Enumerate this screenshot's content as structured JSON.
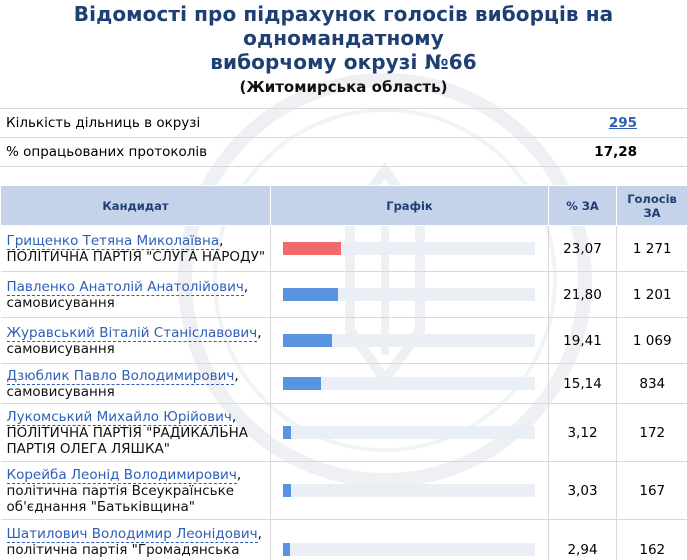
{
  "header": {
    "title_line1": "Відомості про підрахунок голосів виборців на одномандатному",
    "title_line2": "виборчому окрузі №66",
    "region": "(Житомирська область)"
  },
  "summary": {
    "stations_label": "Кількість дільниць в окрузі",
    "stations_value": "295",
    "protocols_label": "% опрацьованих протоколів",
    "protocols_value": "17,28"
  },
  "table": {
    "columns": {
      "candidate": "Кандидат",
      "graph": "Графік",
      "percent": "% ЗА",
      "votes_line1": "Голосів",
      "votes_line2": "ЗА"
    },
    "rows": [
      {
        "name": "Грищенко Тетяна Миколаївна",
        "party": "ПОЛІТИЧНА ПАРТІЯ \"СЛУГА НАРОДУ\"",
        "percent": "23,07",
        "percent_value": 23.07,
        "votes": "1 271"
      },
      {
        "name": "Павленко Анатолій Анатолійович",
        "party": "самовисування",
        "percent": "21,80",
        "percent_value": 21.8,
        "votes": "1 201"
      },
      {
        "name": "Журавський Віталій Станіславович",
        "party": "самовисування",
        "percent": "19,41",
        "percent_value": 19.41,
        "votes": "1 069"
      },
      {
        "name": "Дзюблик Павло Володимирович",
        "party": "самовисування",
        "percent": "15,14",
        "percent_value": 15.14,
        "votes": "834"
      },
      {
        "name": "Лукомський Михайло Юрійович",
        "party": "ПОЛІТИЧНА ПАРТІЯ \"РАДИКАЛЬНА ПАРТІЯ ОЛЕГА ЛЯШКА\"",
        "percent": "3,12",
        "percent_value": 3.12,
        "votes": "172"
      },
      {
        "name": "Корейба Леонід Володимирович",
        "party": "політична партія Всеукраїнське об'єднання \"Батьківщина\"",
        "percent": "3,03",
        "percent_value": 3.03,
        "votes": "167"
      },
      {
        "name": "Шатилович Володимир Леонідович",
        "party": "політична партія \"Громадянська позиція\"",
        "percent": "2,94",
        "percent_value": 2.94,
        "votes": "162"
      }
    ]
  },
  "colors": {
    "title": "#1f3f73",
    "link": "#2e5fb8",
    "header_bg": "#c5d3ea",
    "bar": "#5894e0",
    "bar_leader": "#f26a6a",
    "bar_track": "#eaeef5"
  }
}
